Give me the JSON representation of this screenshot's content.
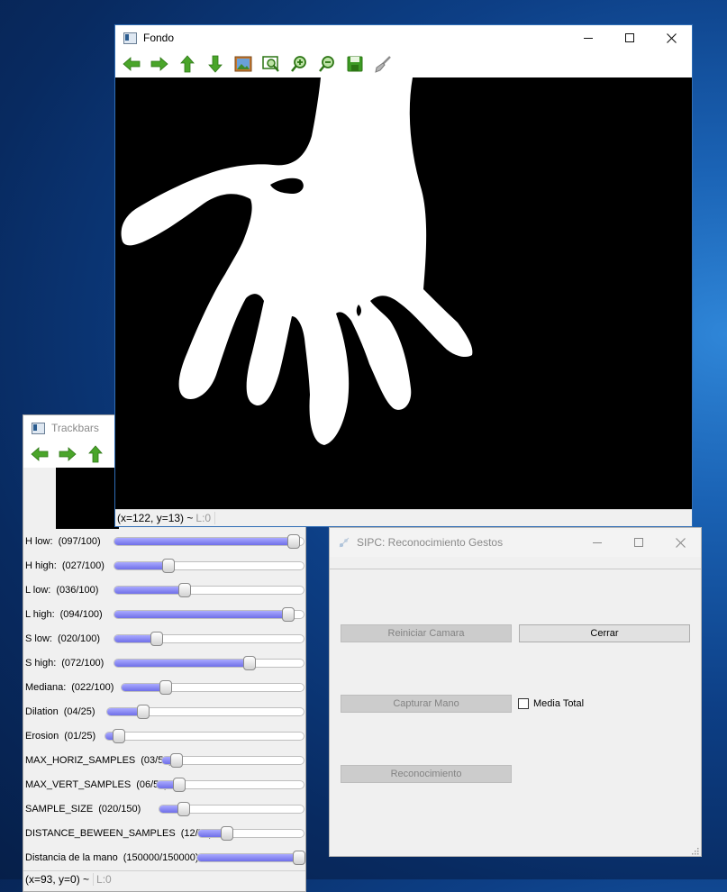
{
  "fondo": {
    "title": "Fondo",
    "toolbar": {
      "items": [
        {
          "name": "arrow-left-icon"
        },
        {
          "name": "arrow-right-icon"
        },
        {
          "name": "arrow-up-icon"
        },
        {
          "name": "arrow-down-icon"
        },
        {
          "name": "image-icon"
        },
        {
          "name": "zoom-fit-icon"
        },
        {
          "name": "zoom-in-icon"
        },
        {
          "name": "zoom-out-icon"
        },
        {
          "name": "save-icon"
        },
        {
          "name": "brush-icon"
        }
      ]
    },
    "status_coords": "(x=122, y=13) ~",
    "status_l": "L:0"
  },
  "trackbars": {
    "title": "Trackbars",
    "sliders": [
      {
        "label": "H low:",
        "value_text": "(097/100)",
        "fraction": 0.97
      },
      {
        "label": "H high:",
        "value_text": "(027/100)",
        "fraction": 0.27
      },
      {
        "label": "L low:",
        "value_text": "(036/100)",
        "fraction": 0.36
      },
      {
        "label": "L high:",
        "value_text": "(094/100)",
        "fraction": 0.94
      },
      {
        "label": "S low:",
        "value_text": "(020/100)",
        "fraction": 0.2
      },
      {
        "label": "S high:",
        "value_text": "(072/100)",
        "fraction": 0.72
      },
      {
        "label": "Mediana:",
        "value_text": "(022/100)",
        "fraction": 0.22
      },
      {
        "label": "Dilation",
        "value_text": "(04/25)",
        "fraction": 0.16
      },
      {
        "label": "Erosion",
        "value_text": "(01/25)",
        "fraction": 0.04
      },
      {
        "label": "MAX_HORIZ_SAMPLES",
        "value_text": "(03/50)",
        "fraction": 0.06
      },
      {
        "label": "MAX_VERT_SAMPLES",
        "value_text": "(06/50)",
        "fraction": 0.12
      },
      {
        "label": "SAMPLE_SIZE",
        "value_text": "(020/150)",
        "fraction": 0.133
      },
      {
        "label": "DISTANCE_BEWEEN_SAMPLES",
        "value_text": "(12/50)",
        "fraction": 0.24
      },
      {
        "label": "Distancia de la mano",
        "value_text": "(150000/150000)",
        "fraction": 1.0
      }
    ],
    "status_coords": "(x=93, y=0) ~",
    "status_l": "L:0"
  },
  "sipc": {
    "title": "SIPC: Reconocimiento Gestos",
    "buttons": {
      "reiniciar": "Reiniciar Camara",
      "cerrar": "Cerrar",
      "capturar": "Capturar Mano",
      "reconocimiento": "Reconocimiento"
    },
    "checkbox_label": "Media Total"
  },
  "colors": {
    "accent_fill": "#6f6fe8",
    "disabled_button": "#cccccc"
  }
}
